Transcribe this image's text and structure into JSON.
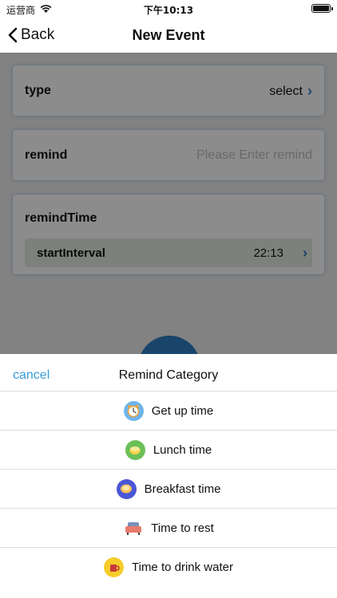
{
  "status_bar": {
    "carrier": "运营商",
    "time": "下午10:13"
  },
  "nav": {
    "back_label": "Back",
    "title": "New Event"
  },
  "form": {
    "type": {
      "label": "type",
      "value": "select"
    },
    "remind": {
      "label": "remind",
      "placeholder": "Please Enter remind"
    },
    "remind_time": {
      "label": "remindTime",
      "interval_label": "startInterval",
      "interval_value": "22:13"
    }
  },
  "sheet": {
    "cancel_label": "cancel",
    "title": "Remind Category",
    "options": [
      {
        "label": "Get up time",
        "icon": "alarm-clock-icon"
      },
      {
        "label": "Lunch time",
        "icon": "lunch-bowl-icon"
      },
      {
        "label": "Breakfast time",
        "icon": "breakfast-icon"
      },
      {
        "label": "Time to rest",
        "icon": "sofa-icon"
      },
      {
        "label": "Time to drink water",
        "icon": "cup-icon"
      }
    ]
  },
  "colors": {
    "accent": "#2f7fc1",
    "link": "#3a9bd9"
  }
}
